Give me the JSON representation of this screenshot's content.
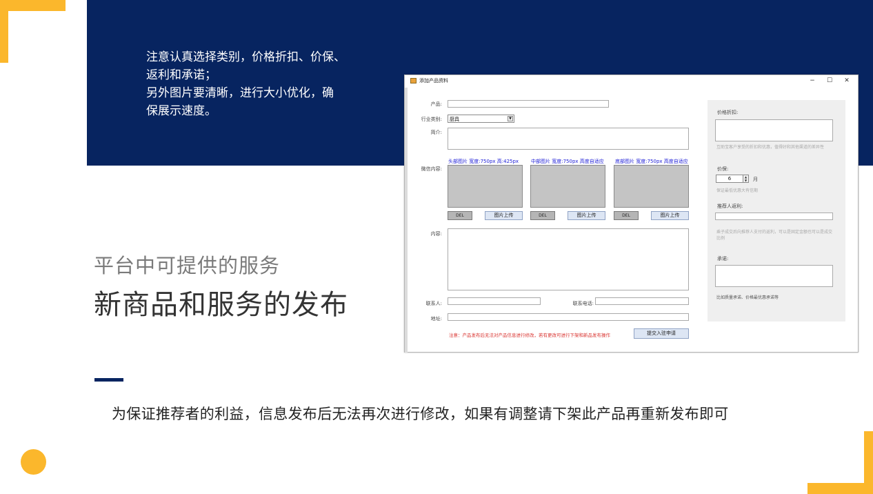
{
  "slide": {
    "notice_line1": "注意认真选择类别，价格折扣、价保、",
    "notice_line2": "返利和承诺；",
    "notice_line3": "另外图片要清晰，进行大小优化，确",
    "notice_line4": "保展示速度。",
    "services_subtitle": "平台中可提供的服务",
    "services_title": "新商品和服务的发布",
    "bottom_text": "为保证推荐者的利益，信息发布后无法再次进行修改，如果有调整请下架此产品再重新发布即可",
    "colors": {
      "navy": "#072460",
      "accent": "#fbb72c"
    }
  },
  "window": {
    "title": "添加产品资料",
    "minimize": "−",
    "maximize": "☐",
    "close": "✕",
    "form": {
      "product_label": "产品:",
      "category_label": "行业类别:",
      "category_value": "厨具",
      "intro_label": "简介:",
      "wechat_label": "微信内容:",
      "header_image_label": "头部图片 宽度:750px 高:425px",
      "middle_image_label": "中部图片 宽度:750px  高度自适应",
      "bottom_image_label": "底部图片 宽度:750px  高度自适应",
      "del_label": "DEL",
      "upload_label": "图片上传",
      "content_label": "内容:",
      "contact_label": "联系人:",
      "phone_label": "联系电话:",
      "address_label": "地址:",
      "note": "注意：产品发布后无法对产品信息进行修改，若有更改可进行下架和新品发布操作",
      "submit_label": "提交入驻申请"
    },
    "side": {
      "discount_label": "价格折扣:",
      "discount_hint": "互助宝客户享受的折扣和优惠，值得好和其他渠道的差异性",
      "price_protect_label": "价保:",
      "price_protect_value": "6",
      "month_label": "月",
      "price_protect_hint": "保证最低优惠大有信期",
      "referral_label": "推荐人返利:",
      "referral_hint": "乘子成交后向推荐人支付的返利，可以是固定金额也可以是成交比例",
      "promise_label": "承诺:",
      "promise_hint": "比如质量承诺、价格最优惠承诺等"
    }
  }
}
